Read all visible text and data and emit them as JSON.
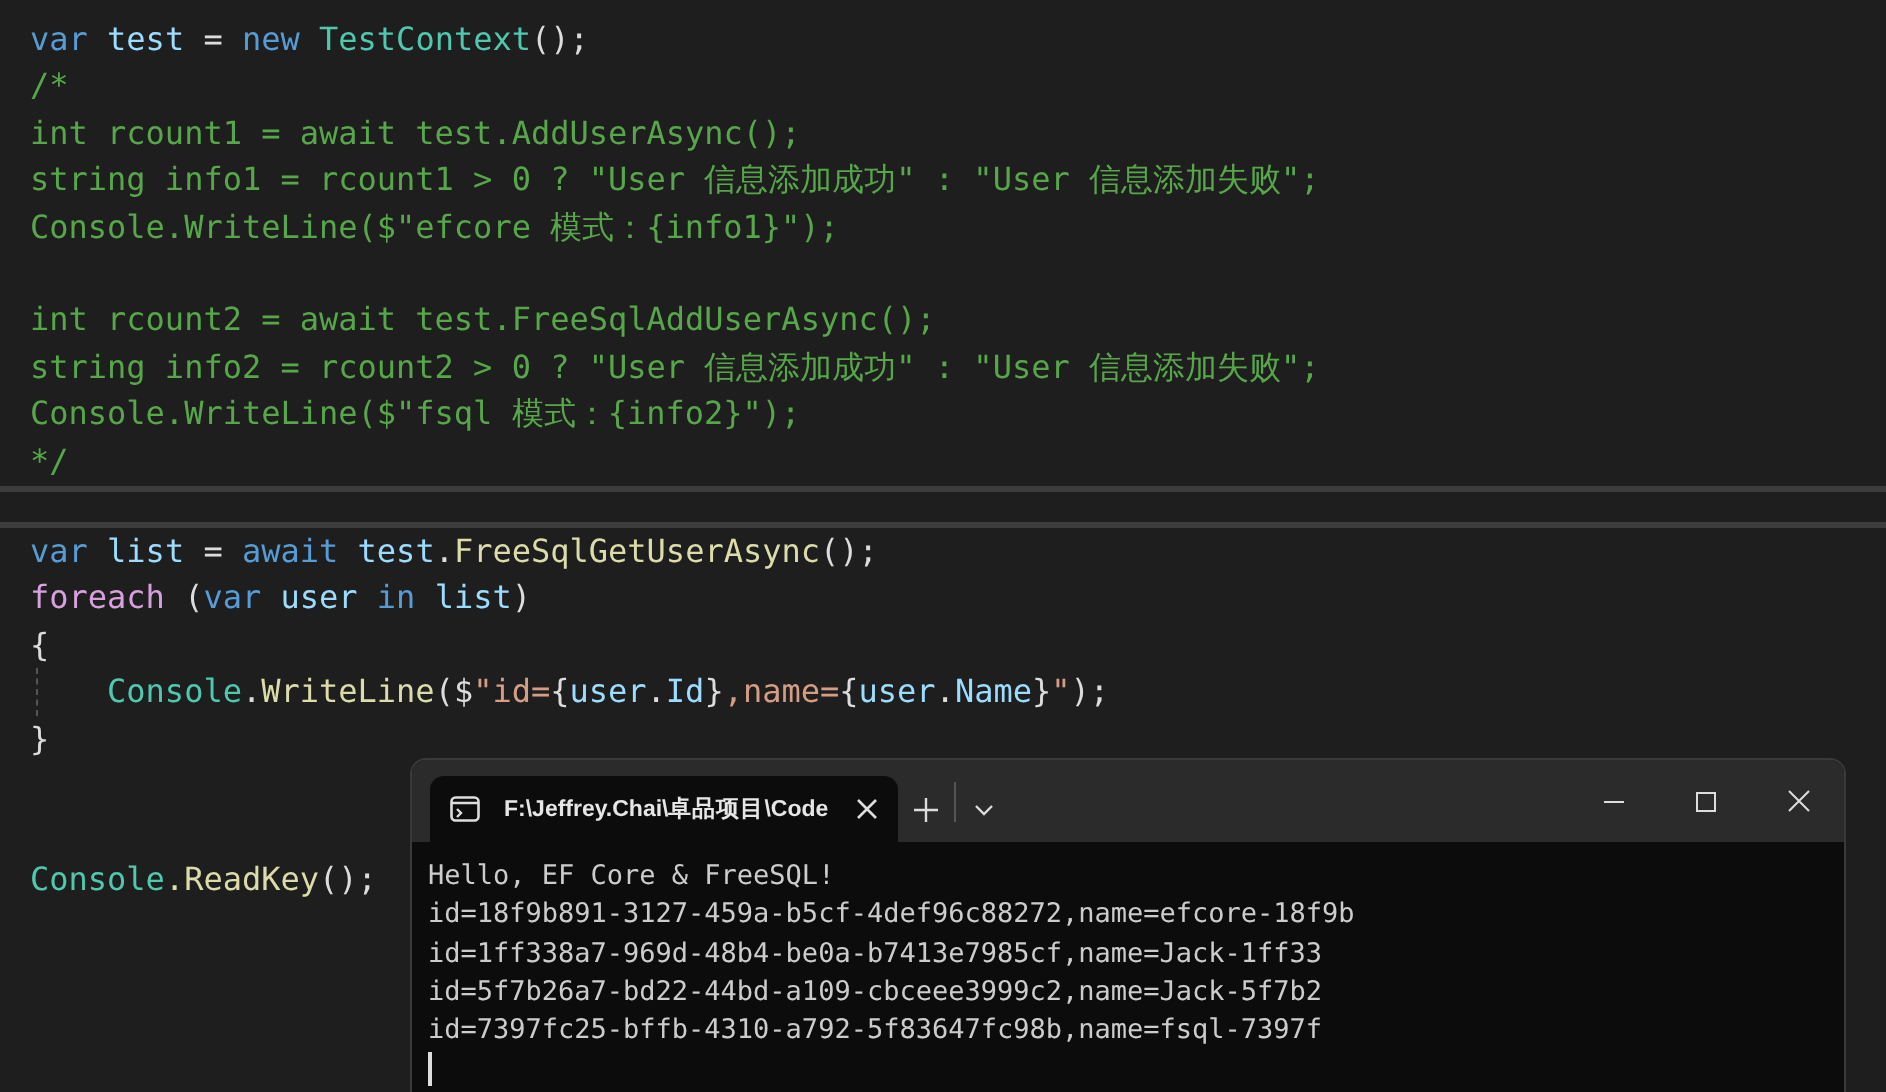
{
  "editor_top": {
    "lines": [
      {
        "kind": "code",
        "tokens": [
          {
            "text": "var",
            "kind": "keyword"
          },
          {
            "text": " test",
            "kind": "variable"
          },
          {
            "text": " = ",
            "kind": "plain"
          },
          {
            "text": "new",
            "kind": "keyword"
          },
          {
            "text": " TestContext",
            "kind": "type"
          },
          {
            "text": "();",
            "kind": "plain"
          }
        ]
      },
      {
        "kind": "code",
        "tokens": [
          {
            "text": "/*",
            "kind": "comment"
          }
        ]
      },
      {
        "kind": "code",
        "tokens": [
          {
            "text": "int rcount1 = await test.AddUserAsync();",
            "kind": "comment"
          }
        ]
      },
      {
        "kind": "code",
        "tokens": [
          {
            "text": "string info1 = rcount1 > 0 ? \"User 信息添加成功\" : \"User 信息添加失败\";",
            "kind": "comment"
          }
        ]
      },
      {
        "kind": "code",
        "tokens": [
          {
            "text": "Console.WriteLine($\"efcore 模式：{info1}\");",
            "kind": "comment"
          }
        ]
      },
      {
        "kind": "blank"
      },
      {
        "kind": "code",
        "tokens": [
          {
            "text": "int rcount2 = await test.FreeSqlAddUserAsync();",
            "kind": "comment"
          }
        ]
      },
      {
        "kind": "code",
        "tokens": [
          {
            "text": "string info2 = rcount2 > 0 ? \"User 信息添加成功\" : \"User 信息添加失败\";",
            "kind": "comment"
          }
        ]
      },
      {
        "kind": "code",
        "tokens": [
          {
            "text": "Console.WriteLine($\"fsql 模式：{info2}\");",
            "kind": "comment"
          }
        ]
      },
      {
        "kind": "code",
        "tokens": [
          {
            "text": "*/",
            "kind": "comment"
          }
        ]
      }
    ]
  },
  "editor_bottom": {
    "lines": [
      {
        "kind": "code",
        "tokens": [
          {
            "text": "var",
            "kind": "keyword"
          },
          {
            "text": " list",
            "kind": "variable"
          },
          {
            "text": " = ",
            "kind": "plain"
          },
          {
            "text": "await",
            "kind": "keyword"
          },
          {
            "text": " test",
            "kind": "variable"
          },
          {
            "text": ".",
            "kind": "plain"
          },
          {
            "text": "FreeSqlGetUserAsync",
            "kind": "method"
          },
          {
            "text": "();",
            "kind": "plain"
          }
        ]
      },
      {
        "kind": "code",
        "tokens": [
          {
            "text": "foreach",
            "kind": "control"
          },
          {
            "text": " (",
            "kind": "plain"
          },
          {
            "text": "var",
            "kind": "keyword"
          },
          {
            "text": " user",
            "kind": "variable"
          },
          {
            "text": " in",
            "kind": "keyword"
          },
          {
            "text": " list",
            "kind": "variable"
          },
          {
            "text": ")",
            "kind": "plain"
          }
        ]
      },
      {
        "kind": "code",
        "tokens": [
          {
            "text": "{",
            "kind": "plain"
          }
        ]
      },
      {
        "kind": "code",
        "indent_guide": true,
        "tokens": [
          {
            "text": "    Console",
            "kind": "type"
          },
          {
            "text": ".",
            "kind": "plain"
          },
          {
            "text": "WriteLine",
            "kind": "method"
          },
          {
            "text": "($",
            "kind": "plain"
          },
          {
            "text": "\"id=",
            "kind": "string"
          },
          {
            "text": "{",
            "kind": "plain"
          },
          {
            "text": "user",
            "kind": "variable"
          },
          {
            "text": ".",
            "kind": "plain"
          },
          {
            "text": "Id",
            "kind": "variable"
          },
          {
            "text": "}",
            "kind": "plain"
          },
          {
            "text": ",name=",
            "kind": "string"
          },
          {
            "text": "{",
            "kind": "plain"
          },
          {
            "text": "user",
            "kind": "variable"
          },
          {
            "text": ".",
            "kind": "plain"
          },
          {
            "text": "Name",
            "kind": "variable"
          },
          {
            "text": "}",
            "kind": "plain"
          },
          {
            "text": "\"",
            "kind": "string"
          },
          {
            "text": ");",
            "kind": "plain"
          }
        ]
      },
      {
        "kind": "code",
        "tokens": [
          {
            "text": "}",
            "kind": "plain"
          }
        ]
      },
      {
        "kind": "blank"
      },
      {
        "kind": "blank"
      },
      {
        "kind": "code",
        "tokens": [
          {
            "text": "Console",
            "kind": "type"
          },
          {
            "text": ".ReadKey",
            "kind": "method"
          },
          {
            "text": "();",
            "kind": "plain"
          }
        ]
      }
    ]
  },
  "terminal": {
    "tab": {
      "title": "F:\\Jeffrey.Chai\\卓品项目\\Code",
      "selected": true
    },
    "output": [
      "Hello, EF Core & FreeSQL!",
      "id=18f9b891-3127-459a-b5cf-4def96c88272,name=efcore-18f9b",
      "id=1ff338a7-969d-48b4-be0a-b7413e7985cf,name=Jack-1ff33",
      "id=5f7b26a7-bd22-44bd-a109-cbceee3999c2,name=Jack-5f7b2",
      "id=7397fc25-bffb-4310-a792-5f83647fc98b,name=fsql-7397f"
    ]
  }
}
